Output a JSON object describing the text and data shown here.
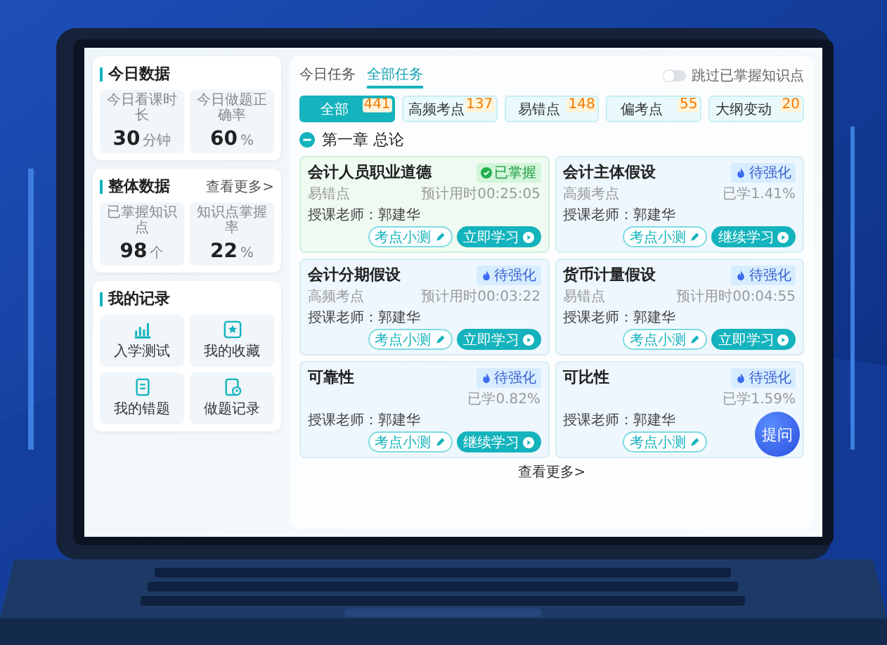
{
  "sidebar": {
    "today": {
      "title": "今日数据",
      "stats": [
        {
          "label": "今日看课时长",
          "value": "30",
          "unit": "分钟"
        },
        {
          "label": "今日做题正确率",
          "value": "60",
          "unit": "%"
        }
      ]
    },
    "overall": {
      "title": "整体数据",
      "more": "查看更多>",
      "stats": [
        {
          "label": "已掌握知识点",
          "value": "98",
          "unit": "个"
        },
        {
          "label": "知识点掌握率",
          "value": "22",
          "unit": "%"
        }
      ]
    },
    "records": {
      "title": "我的记录",
      "items": [
        {
          "label": "入学测试",
          "kind": "chart"
        },
        {
          "label": "我的收藏",
          "kind": "star"
        },
        {
          "label": "我的错题",
          "kind": "book"
        },
        {
          "label": "做题记录",
          "kind": "clock"
        }
      ]
    }
  },
  "tabs": [
    {
      "label": "今日任务",
      "selected": false
    },
    {
      "label": "全部任务",
      "selected": true
    }
  ],
  "skip_toggle": {
    "label": "跳过已掌握知识点",
    "on": false
  },
  "filters": [
    {
      "label": "全部",
      "count": "441",
      "selected": true
    },
    {
      "label": "高频考点",
      "count": "137",
      "selected": false
    },
    {
      "label": "易错点",
      "count": "148",
      "selected": false
    },
    {
      "label": "偏考点",
      "count": "55",
      "selected": false
    },
    {
      "label": "大纲变动",
      "count": "20",
      "selected": false
    }
  ],
  "chapter": {
    "title": "第一章 总论",
    "expanded": true
  },
  "cards": [
    {
      "title": "会计人员职业道德",
      "status": "已掌握",
      "kind": "mastered",
      "tag": "易错点",
      "info": "预计用时00:25:05",
      "teacher": "授课老师：郭建华",
      "quiz": "考点小测",
      "study": "立即学习"
    },
    {
      "title": "会计主体假设",
      "status": "待强化",
      "kind": "weak",
      "tag": "高频考点",
      "info": "已学1.41%",
      "teacher": "授课老师：郭建华",
      "quiz": "考点小测",
      "study": "继续学习"
    },
    {
      "title": "会计分期假设",
      "status": "待强化",
      "kind": "weak",
      "tag": "高频考点",
      "info": "预计用时00:03:22",
      "teacher": "授课老师：郭建华",
      "quiz": "考点小测",
      "study": "立即学习"
    },
    {
      "title": "货币计量假设",
      "status": "待强化",
      "kind": "weak",
      "tag": "易错点",
      "info": "预计用时00:04:55",
      "teacher": "授课老师：郭建华",
      "quiz": "考点小测",
      "study": "立即学习"
    },
    {
      "title": "可靠性",
      "status": "待强化",
      "kind": "weak",
      "info": "已学0.82%",
      "teacher": "授课老师：郭建华",
      "quiz": "考点小测",
      "study": "继续学习"
    },
    {
      "title": "可比性",
      "status": "待强化",
      "kind": "weak",
      "info": "已学1.59%",
      "teacher": "授课老师：郭建华",
      "quiz": "考点小测"
    }
  ],
  "more": "查看更多>",
  "ask_button": "提问"
}
